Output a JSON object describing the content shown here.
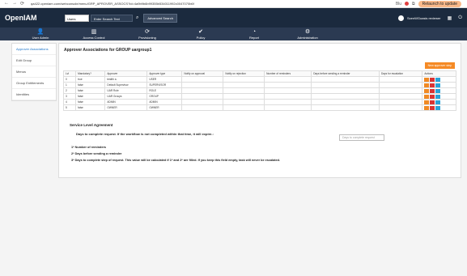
{
  "browser": {
    "url": "qa422.openiam.com/webconsole/menu/GRP_APROVER_ASSOCS?id=4a9b9b6b99355b534011992c0047070b6f",
    "profile_label": "Blu",
    "relaunch_label": "Relaunch to update"
  },
  "header": {
    "logo_main": "Open",
    "logo_accent": "IAM",
    "users_select": "Users",
    "search_placeholder": "Enter Search Text",
    "advanced_search": "Advanced Search",
    "username": "ScenWGoasis reviewer"
  },
  "menu": [
    {
      "label": "User Admin",
      "icon": "👤"
    },
    {
      "label": "Access Control",
      "icon": "▥"
    },
    {
      "label": "Provisioning",
      "icon": "⟳"
    },
    {
      "label": "Policy",
      "icon": "✔"
    },
    {
      "label": "Report",
      "icon": "◔"
    },
    {
      "label": "Administration",
      "icon": "⚙"
    }
  ],
  "sidebar": [
    {
      "label": "Approver Associations",
      "active": true
    },
    {
      "label": "Edit Group",
      "active": false
    },
    {
      "label": "Menus",
      "active": false
    },
    {
      "label": "Group Entitlements",
      "active": false
    },
    {
      "label": "Identities",
      "active": false
    }
  ],
  "main": {
    "title": "Approver Associations for GROUP uargroup1",
    "new_button": "New approver step",
    "columns": [
      "Lvl",
      "Mandatory?",
      "Approver",
      "Approver type",
      "Notify on approval",
      "Notify on rejection",
      "Number of reminders",
      "Days before sending a reminder",
      "Days for escalation",
      "Actions"
    ],
    "rows": [
      [
        "0",
        "true",
        "testlth a.",
        "USER"
      ],
      [
        "1",
        "false",
        "Default Supervisor",
        "SUPERVISOR"
      ],
      [
        "2",
        "false",
        "UAR Role",
        "ROLE"
      ],
      [
        "3",
        "false",
        "UAR Groups",
        "GROUP"
      ],
      [
        "4",
        "false",
        "ADMIN",
        "ADMIN"
      ],
      [
        "5",
        "false",
        "OWNER",
        "OWNER"
      ]
    ]
  },
  "sla": {
    "heading": "Service Level Agreement",
    "question": "Days to complete request. If the workflow is not completed within that time, it will expire.:",
    "input_placeholder": "Days to complete request",
    "note1": "1* Number of reminders",
    "note2": "2* Days before sending a reminder",
    "note3": "3* Days to complete step of request. This value will be calculated if 1* and 2* are filled. If you keep this field empty, task will never be escalated."
  },
  "colors": {
    "header": "#1b2a3e",
    "menubar": "#2b3a52",
    "accent": "#f58a25"
  }
}
